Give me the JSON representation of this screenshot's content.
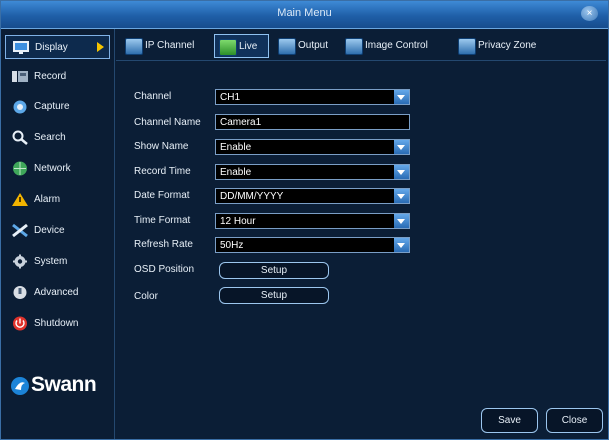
{
  "window": {
    "title": "Main Menu",
    "close_glyph": "×"
  },
  "sidebar": {
    "items": [
      {
        "label": "Display",
        "icon": "display-icon",
        "active": true
      },
      {
        "label": "Record",
        "icon": "record-icon"
      },
      {
        "label": "Capture",
        "icon": "capture-icon"
      },
      {
        "label": "Search",
        "icon": "search-icon"
      },
      {
        "label": "Network",
        "icon": "network-icon"
      },
      {
        "label": "Alarm",
        "icon": "alarm-icon"
      },
      {
        "label": "Device",
        "icon": "device-icon"
      },
      {
        "label": "System",
        "icon": "system-icon"
      },
      {
        "label": "Advanced",
        "icon": "advanced-icon"
      },
      {
        "label": "Shutdown",
        "icon": "shutdown-icon"
      }
    ],
    "brand": "Swann"
  },
  "tabs": [
    {
      "label": "IP Channel"
    },
    {
      "label": "Live",
      "active": true
    },
    {
      "label": "Output"
    },
    {
      "label": "Image Control"
    },
    {
      "label": "Privacy Zone"
    }
  ],
  "form": {
    "channel": {
      "label": "Channel",
      "value": "CH1"
    },
    "channel_name": {
      "label": "Channel Name",
      "value": "Camera1"
    },
    "show_name": {
      "label": "Show Name",
      "value": "Enable"
    },
    "record_time": {
      "label": "Record Time",
      "value": "Enable"
    },
    "date_format": {
      "label": "Date Format",
      "value": "DD/MM/YYYY"
    },
    "time_format": {
      "label": "Time Format",
      "value": "12 Hour"
    },
    "refresh_rate": {
      "label": "Refresh Rate",
      "value": "50Hz"
    },
    "osd_position": {
      "label": "OSD Position",
      "button": "Setup"
    },
    "color": {
      "label": "Color",
      "button": "Setup"
    }
  },
  "footer": {
    "save": "Save",
    "close": "Close"
  },
  "colors": {
    "accent": "#1f5fa8",
    "active_arrow": "#f5c400",
    "dropdown_arrow": "#3a7fcc"
  }
}
